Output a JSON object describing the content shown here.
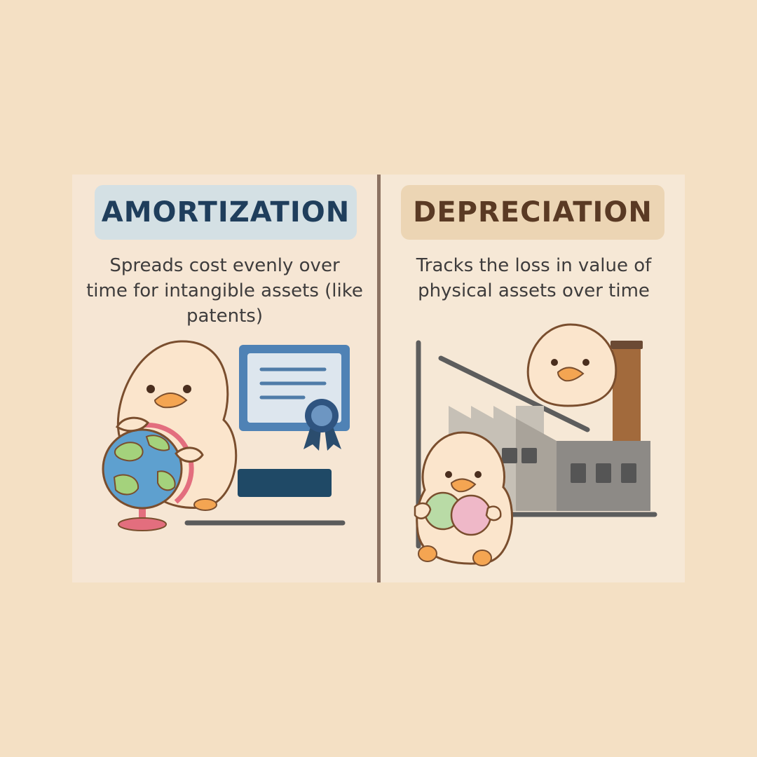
{
  "panels": {
    "left": {
      "title": "AMORTIZATION",
      "description": "Spreads cost evenly over time for intangible assets (like patents)",
      "accent_color": "#1f3e5c",
      "pill_color": "#d4e0e4"
    },
    "right": {
      "title": "DEPRECIATION",
      "description": "Tracks the loss in value of physical assets over time",
      "accent_color": "#5a3a24",
      "pill_color": "#ecd5b4"
    }
  },
  "colors": {
    "background": "#f4e0c4",
    "divider": "#8c7262",
    "duck_body": "#fbe5cc",
    "duck_beak": "#f4a552",
    "outline": "#7a4e2e"
  }
}
